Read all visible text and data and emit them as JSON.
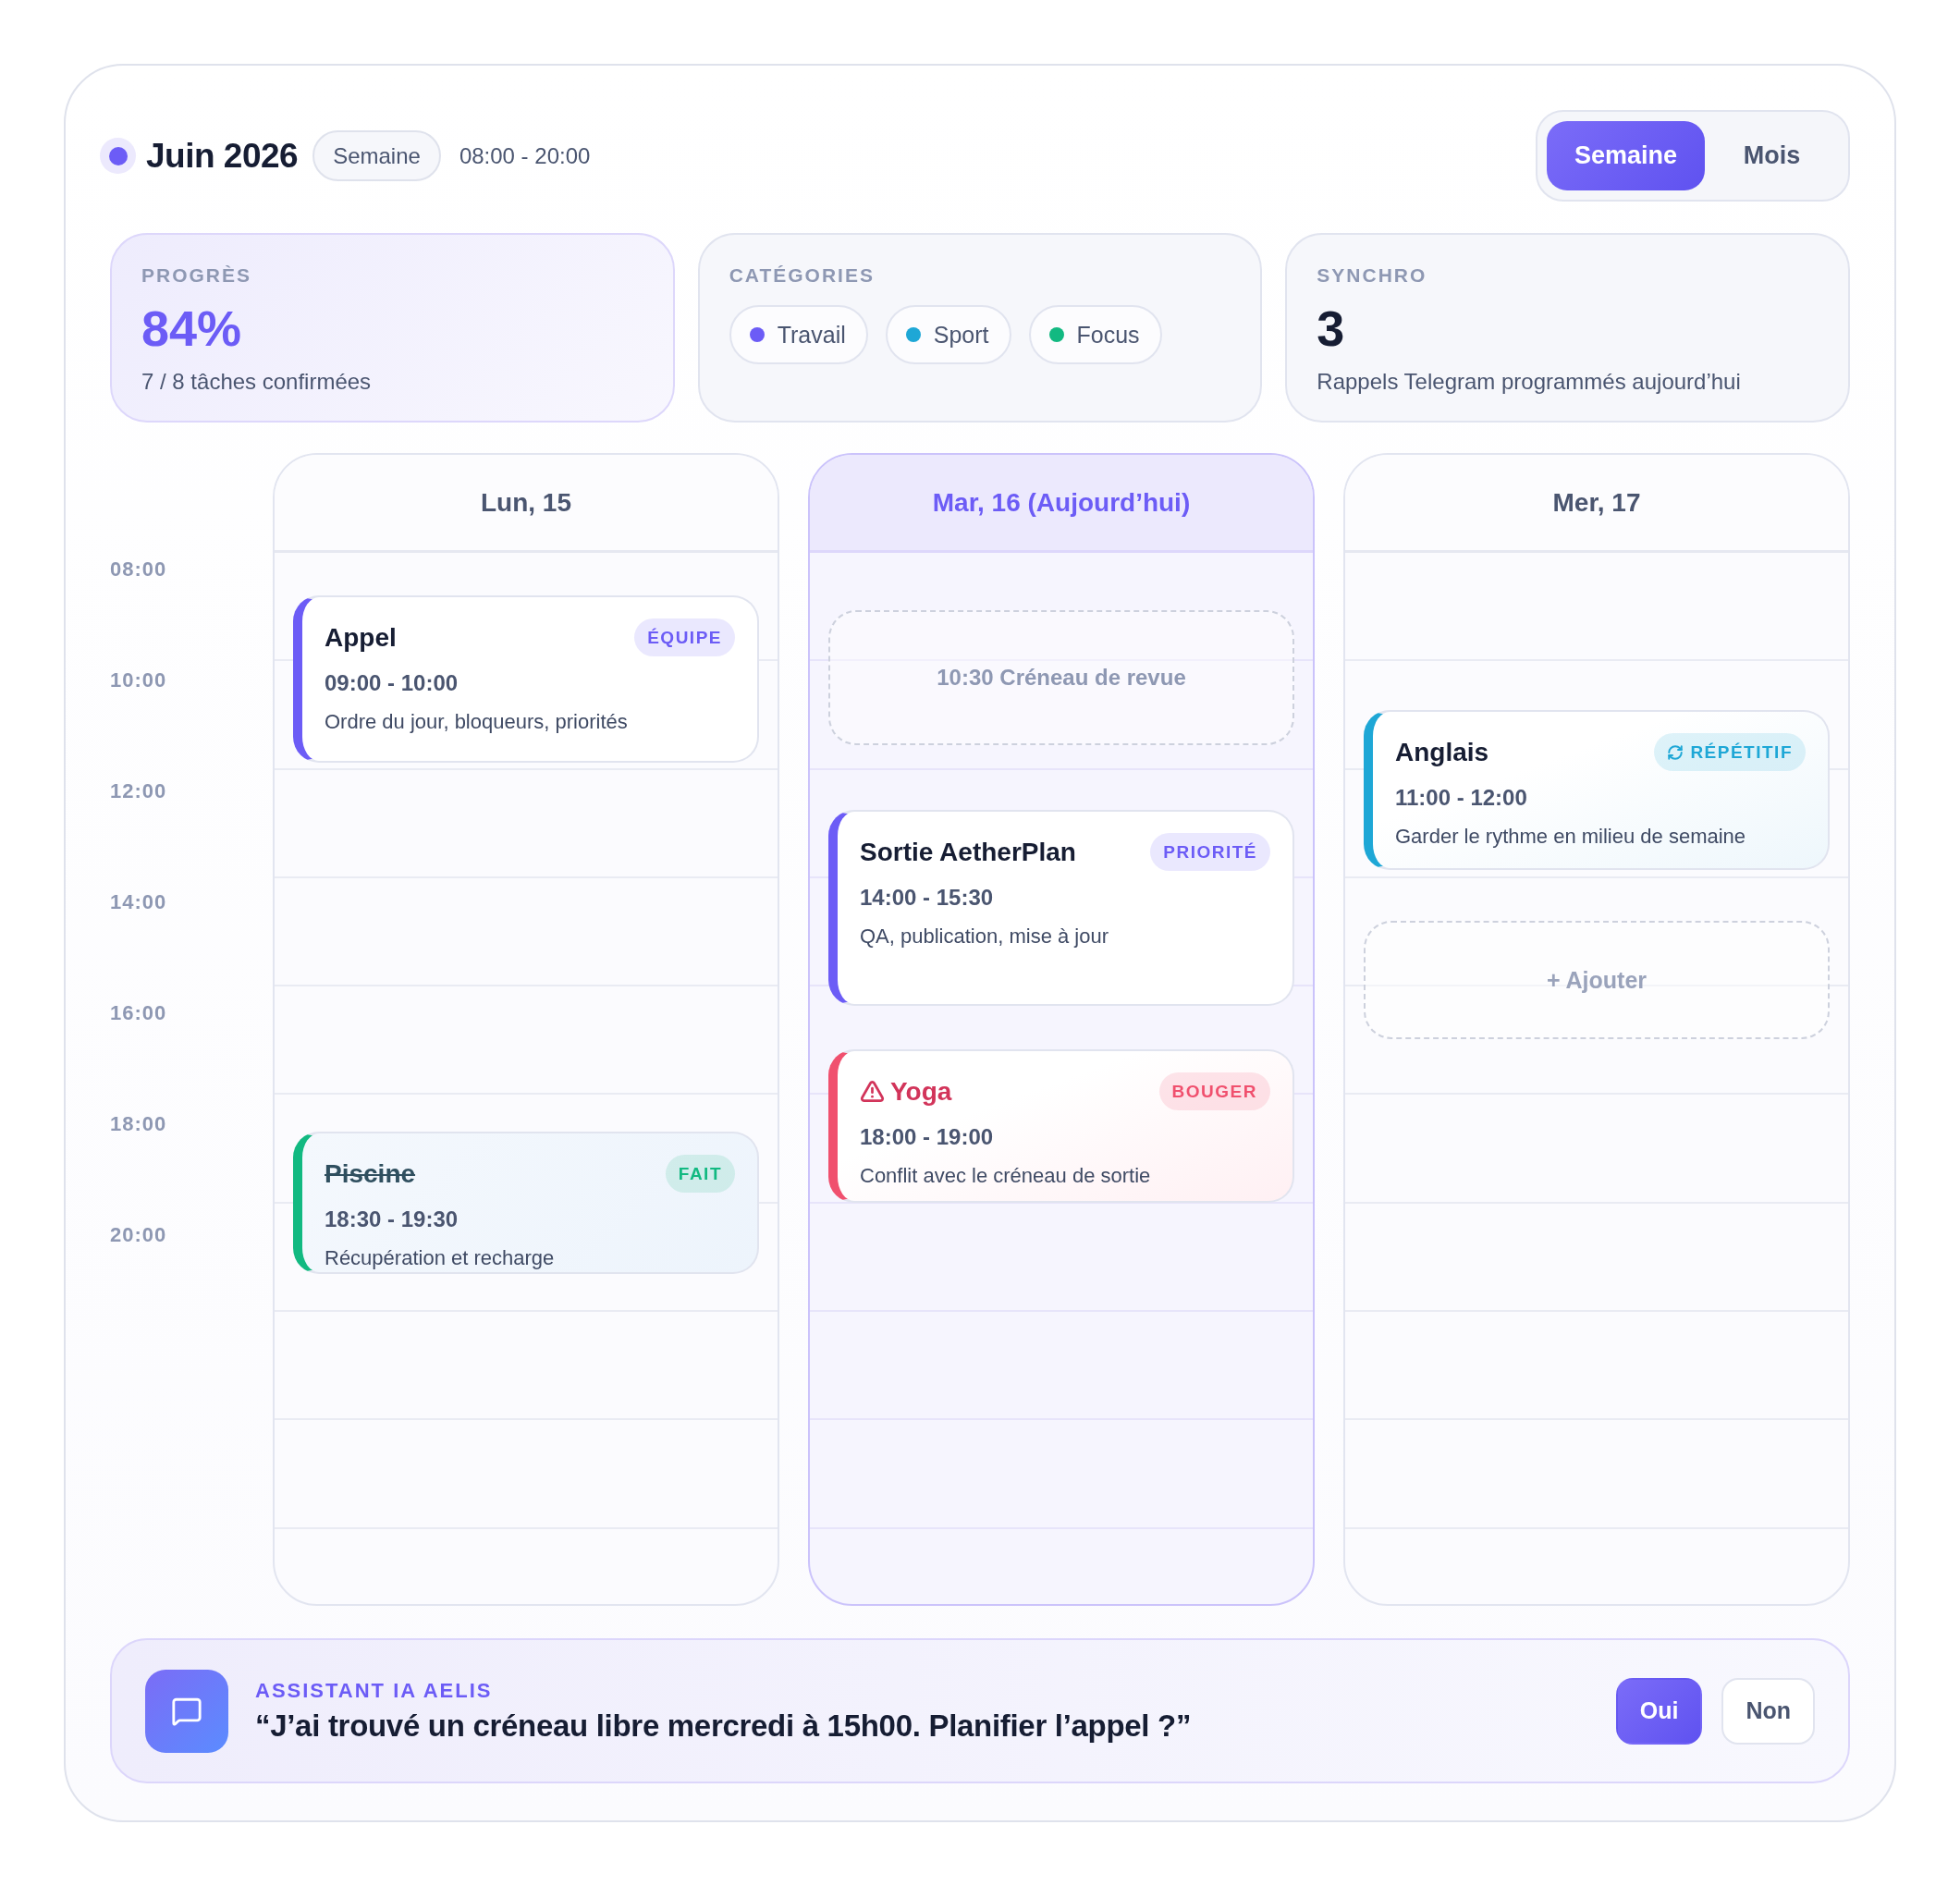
{
  "header": {
    "title": "Juin 2026",
    "range_badge": "Semaine",
    "hours": "08:00 - 20:00"
  },
  "view_toggle": [
    {
      "label": "Semaine",
      "selected": true
    },
    {
      "label": "Mois",
      "selected": false
    }
  ],
  "stats": [
    {
      "kind": "progress",
      "label": "PROGRÈS",
      "value": "84%",
      "caption": "7 / 8 tâches confirmées"
    },
    {
      "kind": "categories",
      "label": "CATÉGORIES",
      "categories": [
        {
          "name": "Travail",
          "color": "#6c5cf6"
        },
        {
          "name": "Sport",
          "color": "#1ea7d6"
        },
        {
          "name": "Focus",
          "color": "#12b981"
        }
      ]
    },
    {
      "kind": "count",
      "label": "SYNCHRO",
      "value": "3",
      "caption": "Rappels Telegram programmés aujourd’hui"
    }
  ],
  "time_labels": [
    "08:00",
    "10:00",
    "12:00",
    "14:00",
    "16:00",
    "18:00",
    "20:00"
  ],
  "days": [
    {
      "label": "Lun, 15",
      "today": false,
      "items": [
        {
          "kind": "event",
          "title": "Appel",
          "tag": "ÉQUIPE",
          "time": "09:00 - 10:00",
          "note": "Ordre du jour, bloqueurs, priorités",
          "color": "#6c5cf6",
          "done": false,
          "conflict": false,
          "recurring": false
        },
        {
          "kind": "event",
          "title": "Piscine",
          "tag": "FAIT",
          "time": "18:30 - 19:30",
          "note": "Récupération et recharge",
          "color": "#12b981",
          "done": true,
          "conflict": false,
          "recurring": false
        }
      ]
    },
    {
      "label": "Mar, 16 (Aujourd’hui)",
      "today": true,
      "items": [
        {
          "kind": "slot",
          "label": "10:30 Créneau de revue"
        },
        {
          "kind": "event",
          "title": "Sortie AetherPlan",
          "tag": "PRIORITÉ",
          "time": "14:00 - 15:30",
          "note": "QA, publication, mise à jour",
          "color": "#6c5cf6",
          "done": false,
          "conflict": false,
          "recurring": false
        },
        {
          "kind": "event",
          "title": "Yoga",
          "tag": "BOUGER",
          "time": "18:00 - 19:00",
          "note": "Conflit avec le créneau de sortie",
          "color": "#f0506e",
          "done": false,
          "conflict": true,
          "recurring": false
        }
      ]
    },
    {
      "label": "Mer, 17",
      "today": false,
      "items": [
        {
          "kind": "event",
          "title": "Anglais",
          "tag": "RÉPÉTITIF",
          "time": "11:00 - 12:00",
          "note": "Garder le rythme en milieu de semaine",
          "color": "#1ea7d6",
          "done": false,
          "conflict": false,
          "recurring": true
        },
        {
          "kind": "add",
          "label": "+ Ajouter"
        }
      ]
    }
  ],
  "assistant": {
    "label": "ASSISTANT IA AELIS",
    "message": "“J’ai trouvé un créneau libre mercredi à 15h00. Planifier l’appel ?”",
    "buttons": [
      {
        "label": "Oui",
        "primary": true
      },
      {
        "label": "Non",
        "primary": false
      }
    ]
  }
}
